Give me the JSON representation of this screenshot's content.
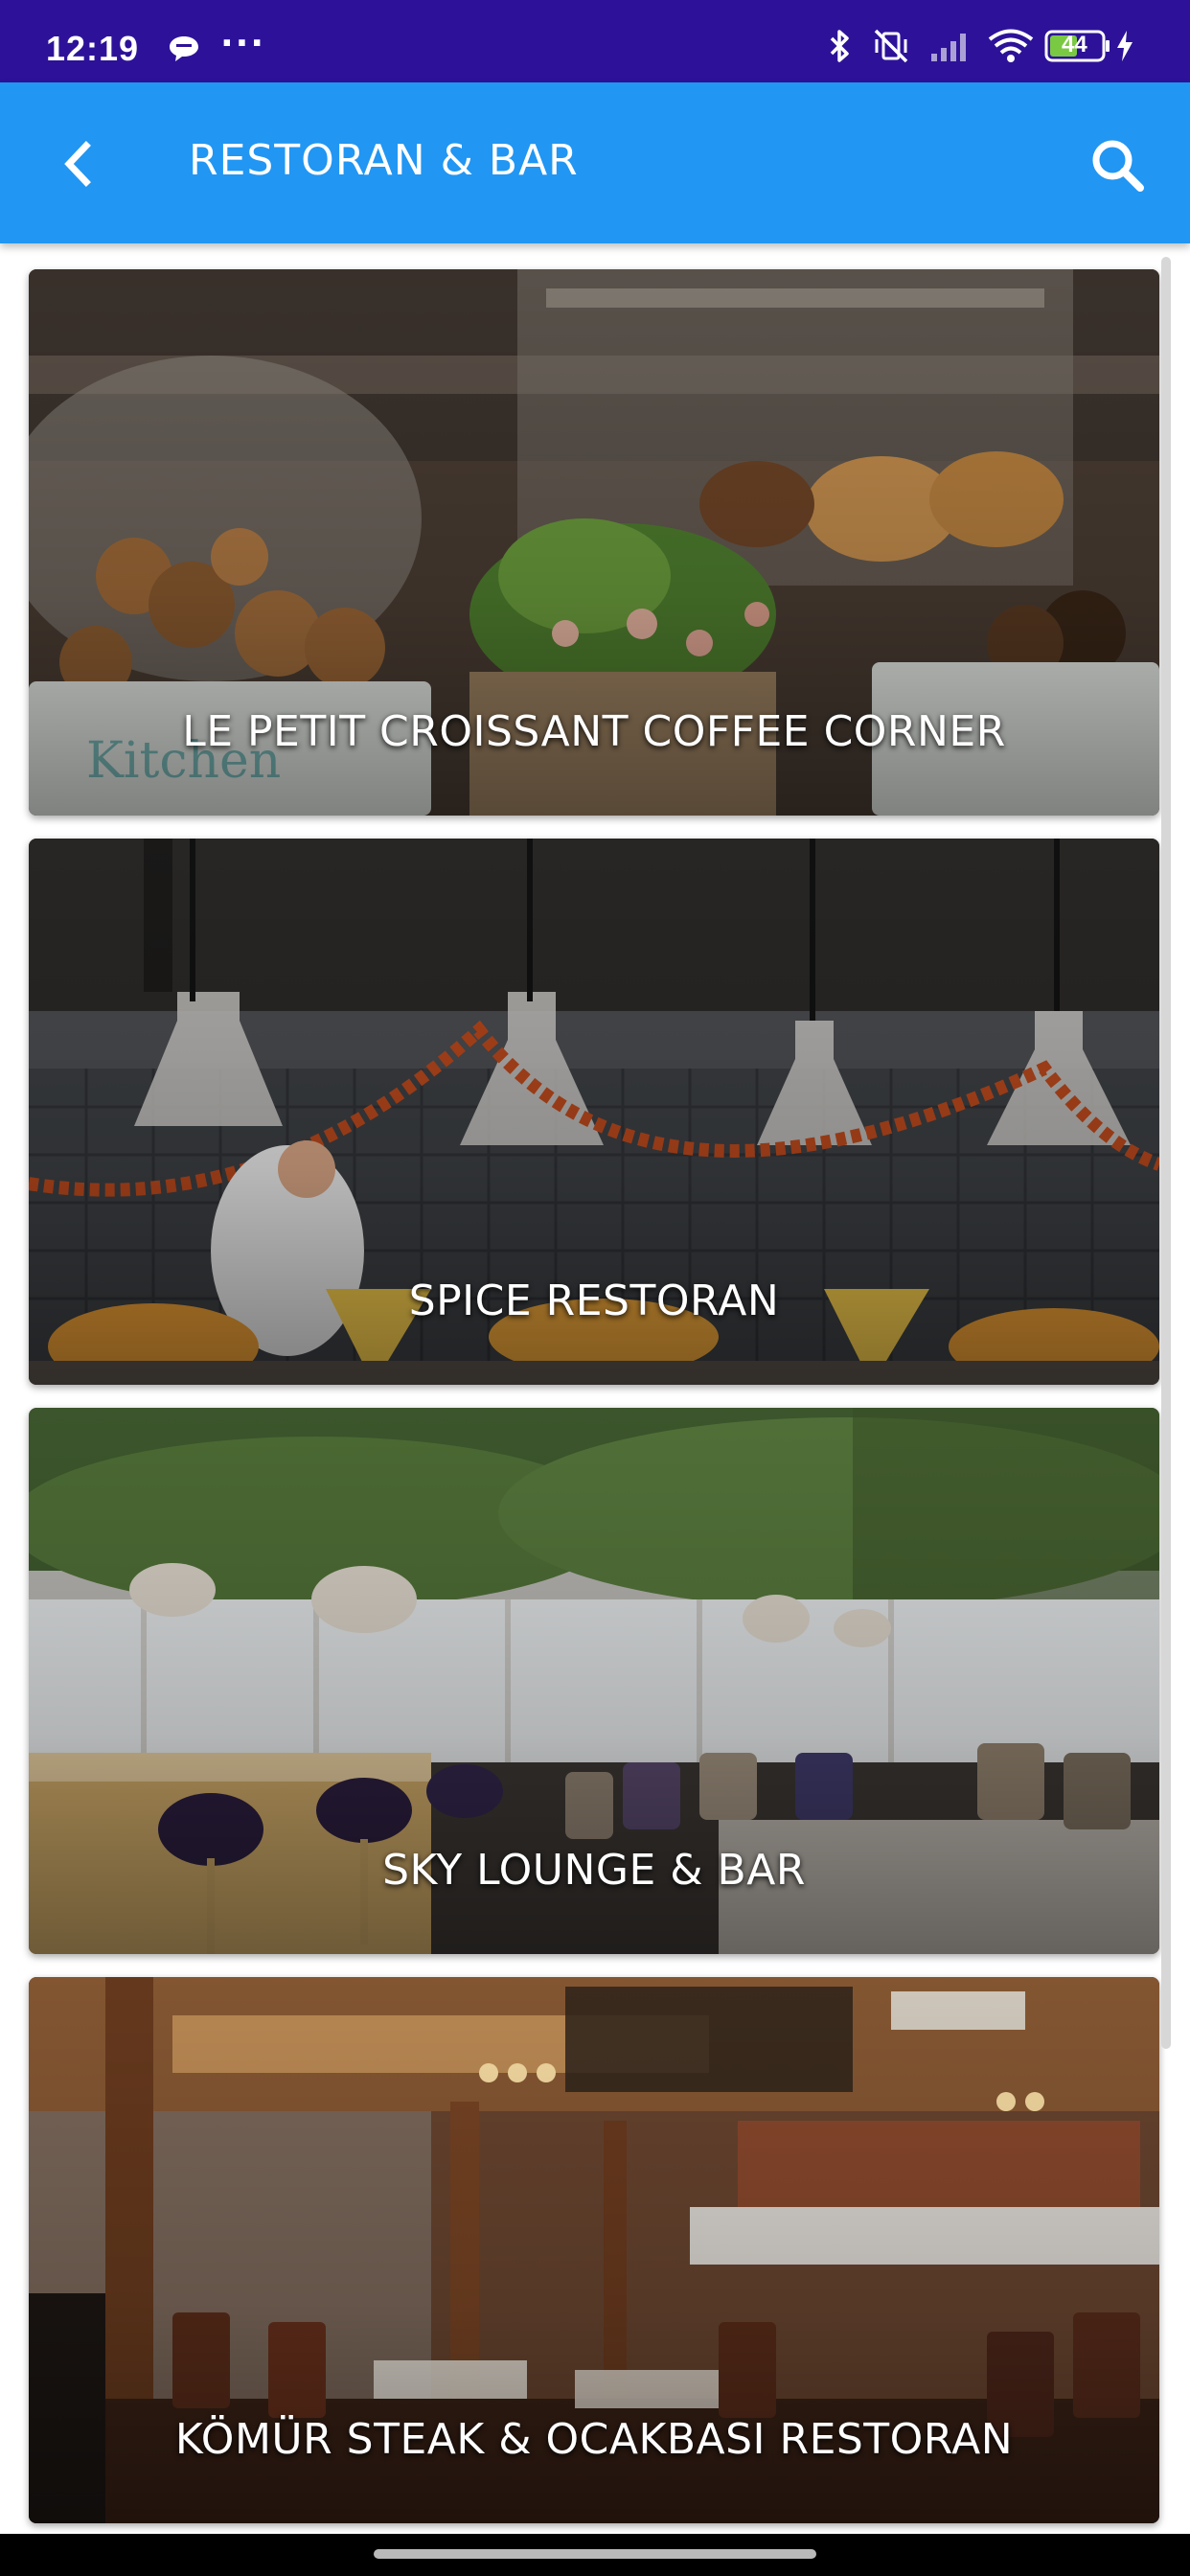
{
  "status_bar": {
    "time": "12:19",
    "more": "···",
    "battery": "44",
    "icons": [
      "chat-bubble-icon",
      "bluetooth-icon",
      "vibrate-off-icon",
      "signal-icon",
      "wifi-icon",
      "battery-icon",
      "charging-icon"
    ]
  },
  "app_bar": {
    "title": "RESTORAN & BAR",
    "background": "#2196f3",
    "back_icon": "chevron-left-icon",
    "search_icon": "search-icon"
  },
  "venues": [
    {
      "name": "LE PETIT CROISSANT COFFEE CORNER",
      "image": "bakery-display-photo"
    },
    {
      "name": "SPICE RESTORAN",
      "image": "kitchen-heat-lamps-photo"
    },
    {
      "name": "SKY LOUNGE & BAR",
      "image": "lounge-bar-interior-photo"
    },
    {
      "name": "KÖMÜR STEAK & OCAKBASI RESTORAN",
      "image": "steakhouse-interior-photo"
    }
  ],
  "colors": {
    "status_bar": "#2d1299",
    "app_bar": "#2196f3",
    "title_text": "#ffffff"
  }
}
